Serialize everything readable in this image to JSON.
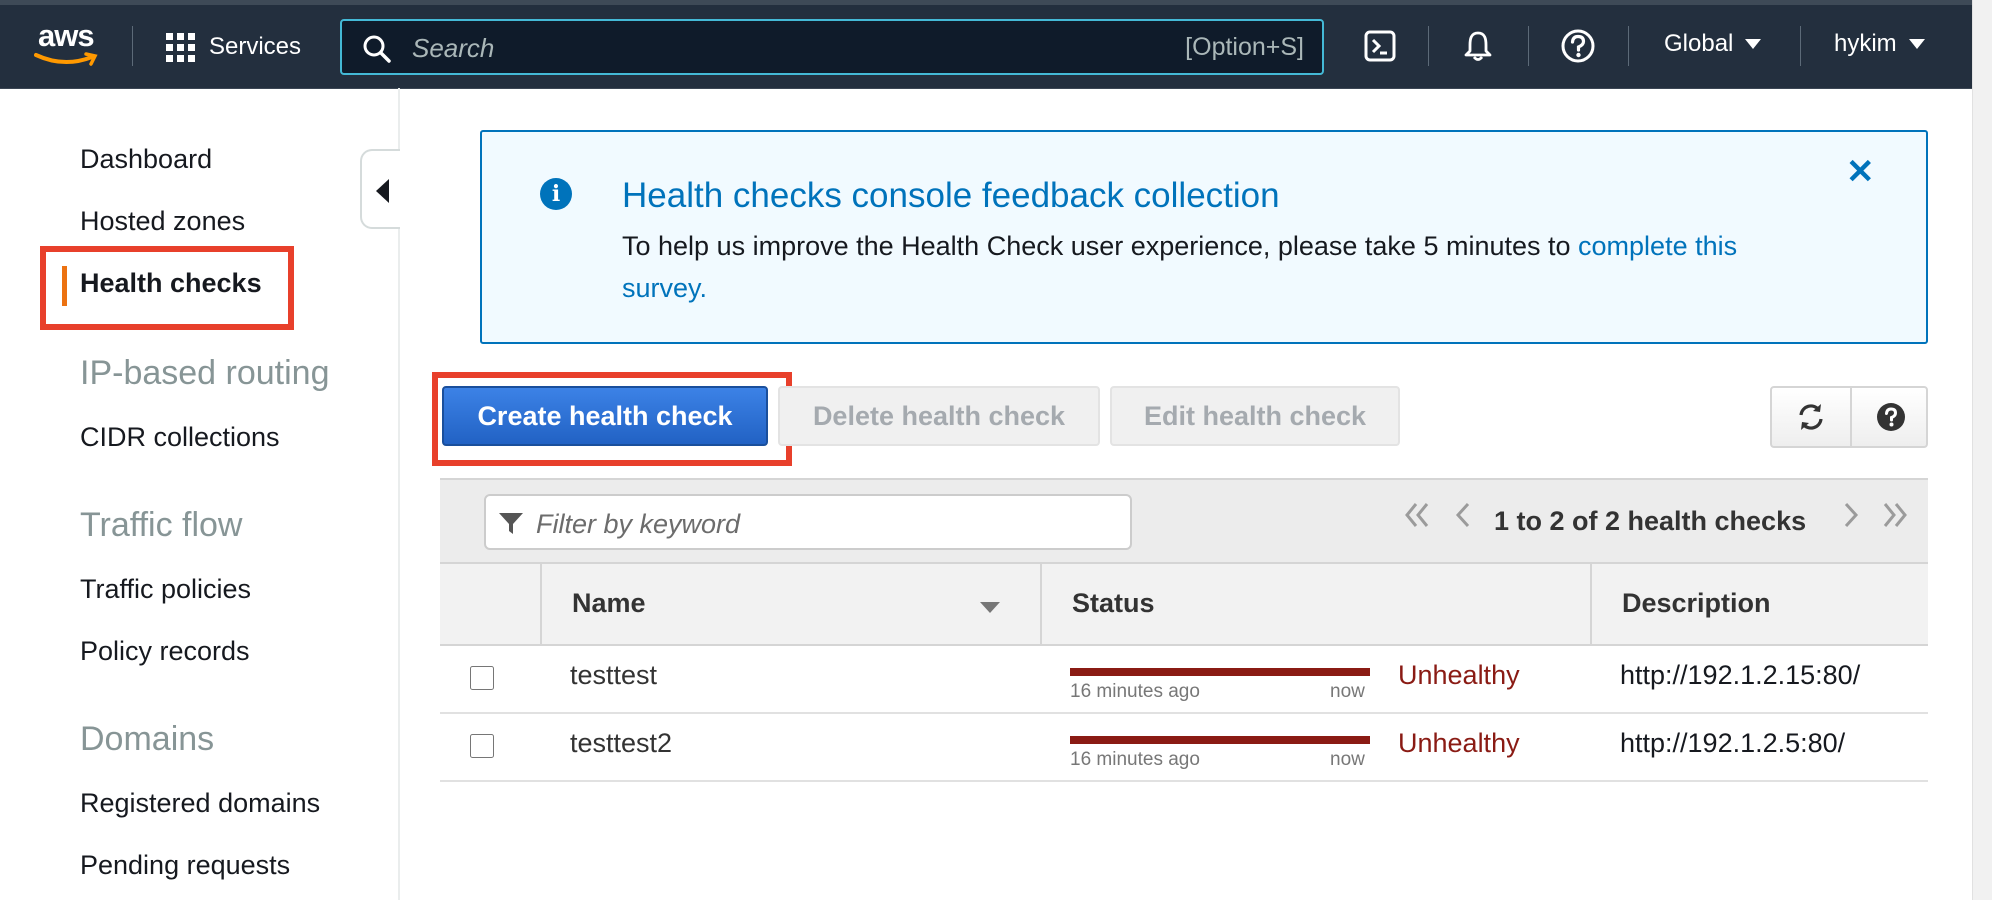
{
  "topnav": {
    "logo_text": "aws",
    "services_label": "Services",
    "search_placeholder": "Search",
    "search_shortcut": "[Option+S]",
    "region_label": "Global",
    "user_label": "hykim"
  },
  "sidebar": {
    "links_top": [
      "Dashboard",
      "Hosted zones",
      "Health checks"
    ],
    "section_ip": "IP-based routing",
    "link_cidr": "CIDR collections",
    "section_traffic": "Traffic flow",
    "link_policies": "Traffic policies",
    "link_records": "Policy records",
    "section_domains": "Domains",
    "link_registered": "Registered domains",
    "link_pending": "Pending requests",
    "active_item": "Health checks"
  },
  "banner": {
    "title": "Health checks console feedback collection",
    "body": "To help us improve the Health Check user experience, please take 5 minutes to ",
    "link": "complete this survey.",
    "close": "✕"
  },
  "toolbar": {
    "create_label": "Create health check",
    "delete_label": "Delete health check",
    "edit_label": "Edit health check"
  },
  "table": {
    "filter_placeholder": "Filter by keyword",
    "pagination": "1 to 2 of 2 health checks",
    "columns": [
      "Name",
      "Status",
      "Description"
    ],
    "rows": [
      {
        "name": "testtest",
        "status": "Unhealthy",
        "bar_start": "16 minutes ago",
        "bar_end": "now",
        "description": "http://192.1.2.15:80/"
      },
      {
        "name": "testtest2",
        "status": "Unhealthy",
        "bar_start": "16 minutes ago",
        "bar_end": "now",
        "description": "http://192.1.2.5:80/"
      }
    ]
  },
  "colors": {
    "nav_bg": "#232f3e",
    "accent_blue": "#0073bb",
    "primary_button": "#2a6fd3",
    "unhealthy": "#8a1b14",
    "highlight_box": "#e8402b",
    "active_marker": "#ec7211"
  }
}
